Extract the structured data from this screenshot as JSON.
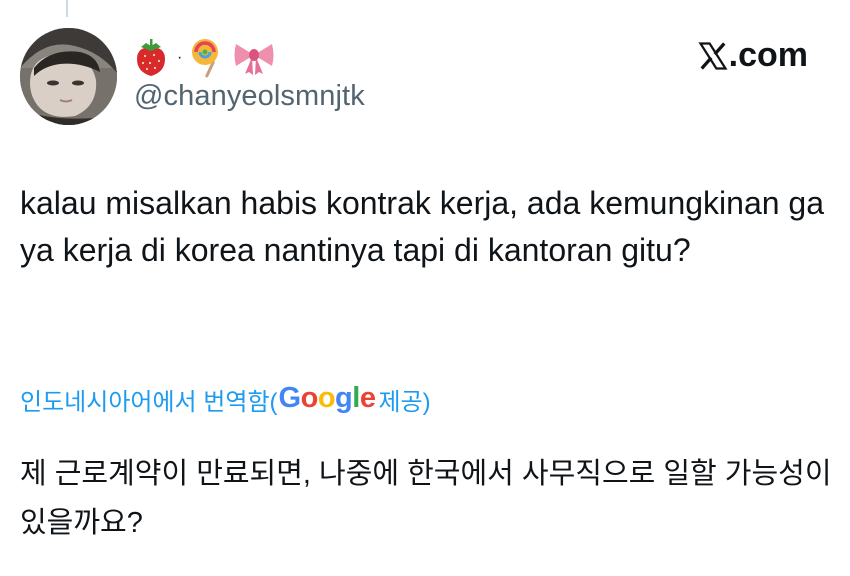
{
  "author": {
    "emoji_name": [
      "strawberry-emoji",
      "lollipop-emoji",
      "ribbon-emoji"
    ],
    "emoji_separator": "·",
    "handle": "@chanyeolsmnjtk"
  },
  "brand": {
    "logo_icon": "x-logo-icon",
    "domain_suffix": ".com"
  },
  "tweet": {
    "text": "kalau misalkan habis kontrak kerja, ada kemungkinan ga ya kerja di korea nantinya tapi di kantoran gitu?"
  },
  "translation": {
    "prefix": "인도네시아어에서 번역함(",
    "provider": "Google",
    "suffix": " 제공)",
    "provider_colors": [
      "#4285F4",
      "#EA4335",
      "#FBBC05",
      "#4285F4",
      "#34A853",
      "#EA4335"
    ],
    "text": "제 근로계약이 만료되면, 나중에 한국에서 사무직으로 일할 가능성이 있을까요?"
  },
  "colors": {
    "link": "#1d9bf0",
    "text": "#0f1419",
    "secondary": "#536471"
  }
}
